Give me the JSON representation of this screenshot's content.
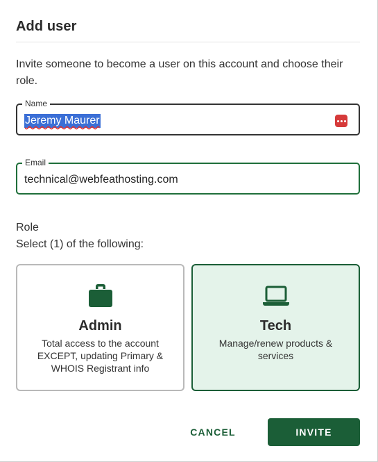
{
  "dialog": {
    "title": "Add user",
    "intro": "Invite someone to become a user on this account and choose their role."
  },
  "form": {
    "name": {
      "label": "Name",
      "value": "Jeremy Maurer"
    },
    "email": {
      "label": "Email",
      "value": "technical@webfeathosting.com"
    }
  },
  "role": {
    "title": "Role",
    "instruction": "Select (1) of the following:",
    "options": [
      {
        "title": "Admin",
        "description": "Total access to the account EXCEPT, updating Primary & WHOIS Registrant info",
        "icon": "briefcase-icon",
        "selected": false
      },
      {
        "title": "Tech",
        "description": "Manage/renew products & services",
        "icon": "laptop-icon",
        "selected": true
      }
    ]
  },
  "actions": {
    "cancel_label": "CANCEL",
    "invite_label": "INVITE"
  },
  "colors": {
    "accent": "#1b5e37",
    "selected_bg": "#e4f3ea",
    "password_manager_icon": "#d63a3a"
  }
}
